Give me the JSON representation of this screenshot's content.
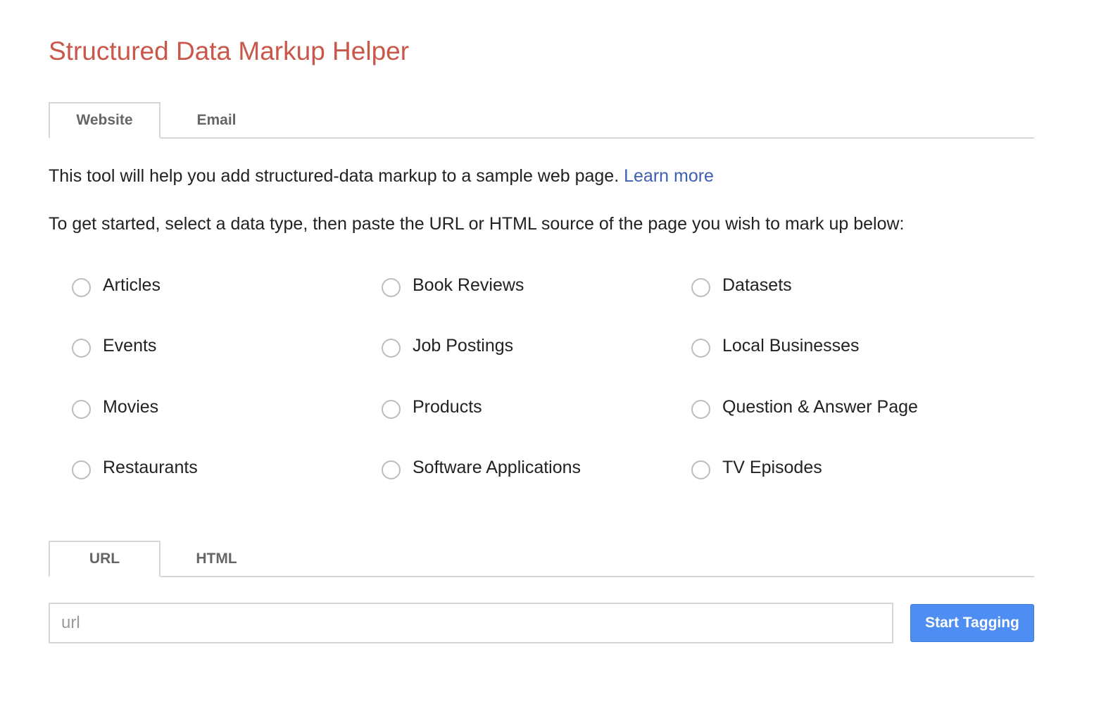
{
  "app": {
    "title": "Structured Data Markup Helper"
  },
  "main_tabs": [
    {
      "label": "Website",
      "active": true
    },
    {
      "label": "Email",
      "active": false
    }
  ],
  "intro": {
    "text": "This tool will help you add structured-data markup to a sample web page.",
    "learn_more": "Learn more"
  },
  "instructions": "To get started, select a data type, then paste the URL or HTML source of the page you wish to mark up below:",
  "data_types": [
    {
      "label": "Articles",
      "selected": false
    },
    {
      "label": "Book Reviews",
      "selected": false
    },
    {
      "label": "Datasets",
      "selected": false
    },
    {
      "label": "Events",
      "selected": false
    },
    {
      "label": "Job Postings",
      "selected": false
    },
    {
      "label": "Local Businesses",
      "selected": false
    },
    {
      "label": "Movies",
      "selected": false
    },
    {
      "label": "Products",
      "selected": false
    },
    {
      "label": "Question & Answer Page",
      "selected": false
    },
    {
      "label": "Restaurants",
      "selected": false
    },
    {
      "label": "Software Applications",
      "selected": false
    },
    {
      "label": "TV Episodes",
      "selected": false
    }
  ],
  "source_tabs": [
    {
      "label": "URL",
      "active": true
    },
    {
      "label": "HTML",
      "active": false
    }
  ],
  "url_input": {
    "value": "",
    "placeholder": "url"
  },
  "start_button": {
    "label": "Start Tagging"
  },
  "colors": {
    "title": "#c9574a",
    "link": "#3f5fb3",
    "button": "#4e8ef2",
    "border": "#d6d6d6"
  }
}
